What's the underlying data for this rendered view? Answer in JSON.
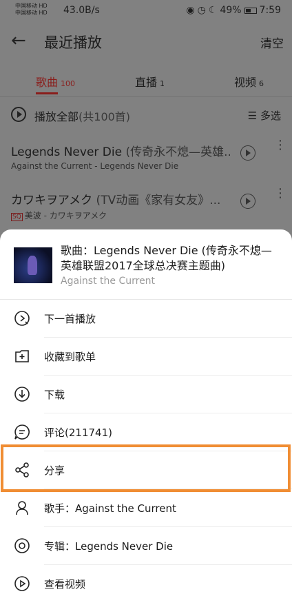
{
  "status_bar": {
    "carrier1": "中国移动 HD",
    "carrier2": "中国移动 HD",
    "net_speed": "43.0B/s",
    "battery": "49%",
    "time": "7:59"
  },
  "header": {
    "title": "最近播放",
    "clear_label": "清空"
  },
  "tabs": [
    {
      "label": "歌曲",
      "count": "100"
    },
    {
      "label": "直播",
      "count": "1"
    },
    {
      "label": "视频",
      "count": "6"
    }
  ],
  "play_all": {
    "label": "播放全部",
    "count": "(共100首)",
    "multi_select": "多选"
  },
  "songs": [
    {
      "title": "Legends Never Die",
      "subtitle": " (传奇永不熄—英雄...",
      "meta": "Against the Current - Legends Never Die",
      "quality": ""
    },
    {
      "title": "カワキヲアメク",
      "subtitle": " (TV动画《家有女友》...",
      "meta": "美波 - カワキヲアメク",
      "quality": "SQ"
    }
  ],
  "sheet": {
    "title": "歌曲：Legends Never Die (传奇永不熄—英雄联盟2017全球总决赛主题曲)",
    "artist": "Against the Current",
    "menu": [
      {
        "label": "下一首播放",
        "icon": "play-next-icon"
      },
      {
        "label": "收藏到歌单",
        "icon": "add-to-playlist-icon"
      },
      {
        "label": "下载",
        "icon": "download-icon"
      },
      {
        "label": "评论(211741)",
        "icon": "comment-icon"
      },
      {
        "label": "分享",
        "icon": "share-icon"
      },
      {
        "label": "歌手：Against the Current",
        "icon": "artist-icon"
      },
      {
        "label": "专辑：Legends Never Die",
        "icon": "album-icon"
      },
      {
        "label": "查看视频",
        "icon": "video-icon"
      }
    ]
  },
  "colors": {
    "accent": "#8a1d1b",
    "highlight": "#f08d33"
  }
}
